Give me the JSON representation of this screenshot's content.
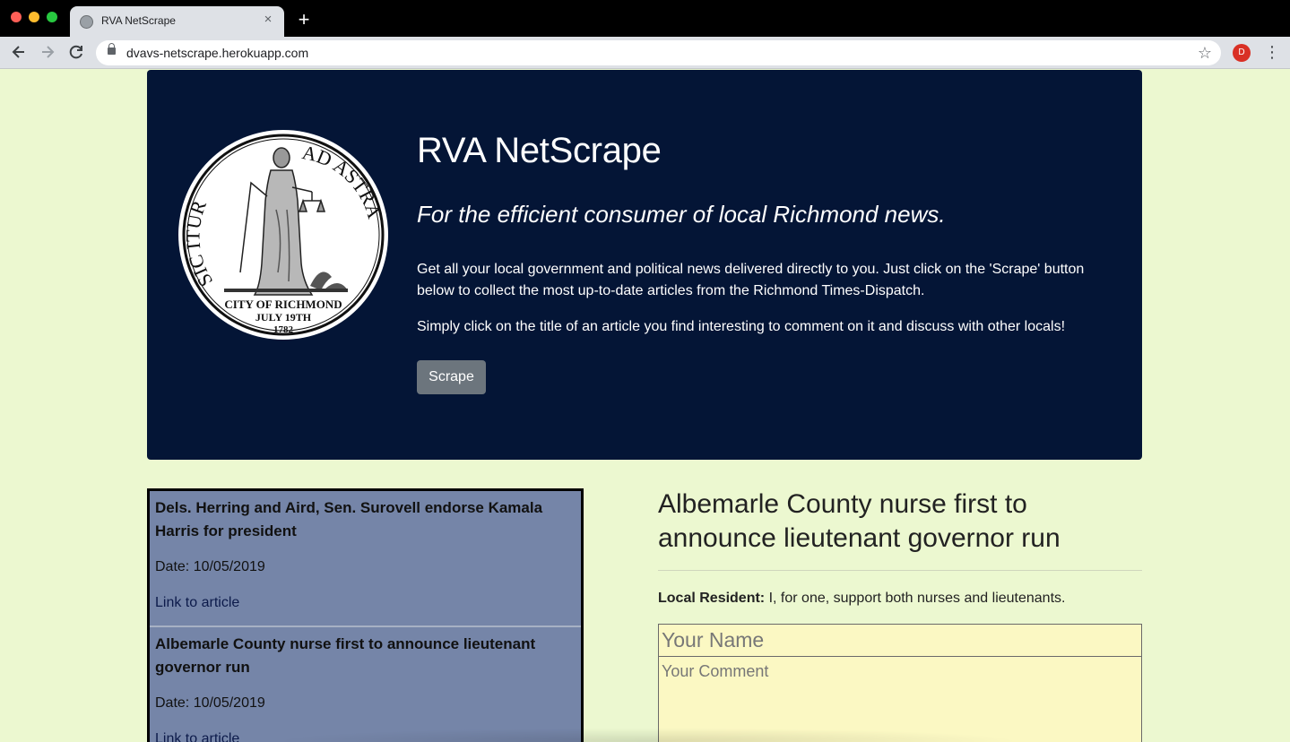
{
  "browser": {
    "tab_title": "RVA NetScrape",
    "tab_close": "×",
    "new_tab": "+",
    "url": "dvavs-netscrape.herokuapp.com",
    "profile_initial": "D",
    "icons": [
      "back-arrow-icon",
      "forward-arrow-icon",
      "reload-icon",
      "lock-icon",
      "star-icon",
      "kebab-menu-icon"
    ]
  },
  "hero": {
    "title": "RVA NetScrape",
    "subtitle": "For the efficient consumer of local Richmond news.",
    "paragraph1": "Get all your local government and political news delivered directly to you. Just click on the 'Scrape' button below to collect the most up-to-date articles from the Richmond Times-Dispatch.",
    "paragraph2": "Simply click on the title of an article you find interesting to comment on it and discuss with other locals!",
    "scrape_label": "Scrape",
    "seal": {
      "motto_left": "SIC ITUR",
      "motto_right": "AD ASTRA",
      "city": "CITY OF RICHMOND",
      "date": "JULY 19TH",
      "year": "1782"
    }
  },
  "articles": [
    {
      "title": "Dels. Herring and Aird, Sen. Surovell endorse Kamala Harris for president",
      "date": "Date: 10/05/2019",
      "link": "Link to article"
    },
    {
      "title": "Albemarle County nurse first to announce lieutenant governor run",
      "date": "Date: 10/05/2019",
      "link": "Link to article"
    }
  ],
  "detail": {
    "title": "Albemarle County nurse first to announce lieutenant governor run",
    "comments": [
      {
        "author": "Local Resident:",
        "text": " I, for one, support both nurses and lieutenants."
      }
    ],
    "name_placeholder": "Your Name",
    "comment_placeholder": "Your Comment"
  },
  "colors": {
    "page_bg": "#ecf8d0",
    "hero_bg": "#041536",
    "article_list_bg": "#7585a8",
    "input_bg": "#fbf8c3",
    "scrape_button": "#6c757d"
  }
}
